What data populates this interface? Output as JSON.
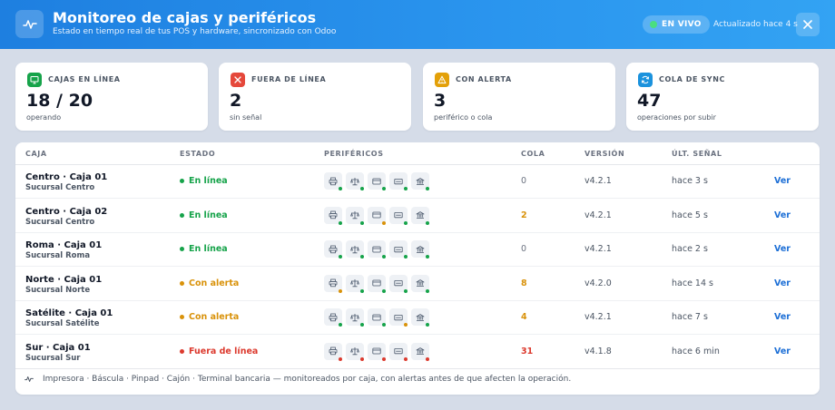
{
  "header": {
    "title": "Monitoreo de cajas y periféricos",
    "subtitle": "Estado en tiempo real de tus POS y hardware, sincronizado con Odoo",
    "live_label": "EN VIVO",
    "updated_label": "Actualizado hace 4 s"
  },
  "cards": [
    {
      "label": "CAJAS EN LÍNEA",
      "value": "18 / 20",
      "sub": "operando",
      "icon": "monitor-icon",
      "color": "#16a34a"
    },
    {
      "label": "FUERA DE LÍNEA",
      "value": "2",
      "sub": "sin señal",
      "icon": "x-icon",
      "color": "#e5483b"
    },
    {
      "label": "CON ALERTA",
      "value": "3",
      "sub": "periférico o cola",
      "icon": "warning-icon",
      "color": "#e3a008"
    },
    {
      "label": "COLA DE SYNC",
      "value": "47",
      "sub": "operaciones por subir",
      "icon": "sync-icon",
      "color": "#1b92dd"
    }
  ],
  "table": {
    "columns": [
      "CAJA",
      "ESTADO",
      "PERIFÉRICOS",
      "COLA",
      "VERSIÓN",
      "ÚLT. SEÑAL"
    ],
    "peripheral_icons": [
      "printer-icon",
      "scale-icon",
      "pinpad-icon",
      "drawer-icon",
      "terminal-icon"
    ],
    "rows": [
      {
        "name": "Centro · Caja 01",
        "branch": "Sucursal Centro",
        "status": "En línea",
        "status_kind": "ok",
        "peripherals": [
          "ok",
          "ok",
          "ok",
          "ok",
          "ok"
        ],
        "queue": "0",
        "queue_kind": "zero",
        "version": "v4.2.1",
        "signal": "hace 3 s",
        "action": "Ver"
      },
      {
        "name": "Centro · Caja 02",
        "branch": "Sucursal Centro",
        "status": "En línea",
        "status_kind": "ok",
        "peripherals": [
          "ok",
          "ok",
          "warn",
          "ok",
          "ok"
        ],
        "queue": "2",
        "queue_kind": "warn",
        "version": "v4.2.1",
        "signal": "hace 5 s",
        "action": "Ver"
      },
      {
        "name": "Roma · Caja 01",
        "branch": "Sucursal Roma",
        "status": "En línea",
        "status_kind": "ok",
        "peripherals": [
          "ok",
          "ok",
          "ok",
          "ok",
          "ok"
        ],
        "queue": "0",
        "queue_kind": "zero",
        "version": "v4.2.1",
        "signal": "hace 2 s",
        "action": "Ver"
      },
      {
        "name": "Norte · Caja 01",
        "branch": "Sucursal Norte",
        "status": "Con alerta",
        "status_kind": "warn",
        "peripherals": [
          "warn",
          "ok",
          "ok",
          "ok",
          "ok"
        ],
        "queue": "8",
        "queue_kind": "warn",
        "version": "v4.2.0",
        "signal": "hace 14 s",
        "action": "Ver"
      },
      {
        "name": "Satélite · Caja 01",
        "branch": "Sucursal Satélite",
        "status": "Con alerta",
        "status_kind": "warn",
        "peripherals": [
          "ok",
          "ok",
          "ok",
          "warn",
          "ok"
        ],
        "queue": "4",
        "queue_kind": "warn",
        "version": "v4.2.1",
        "signal": "hace 7 s",
        "action": "Ver"
      },
      {
        "name": "Sur · Caja 01",
        "branch": "Sucursal Sur",
        "status": "Fuera de línea",
        "status_kind": "err",
        "peripherals": [
          "err",
          "err",
          "err",
          "err",
          "err"
        ],
        "queue": "31",
        "queue_kind": "err",
        "version": "v4.1.8",
        "signal": "hace 6 min",
        "action": "Ver"
      }
    ]
  },
  "footer": {
    "text": "Impresora · Báscula · Pinpad · Cajón · Terminal bancaria — monitoreados por caja, con alertas antes de que afecten la operación.",
    "icon": "pulse-icon"
  },
  "colors": {
    "ok": "#16a34a",
    "warn": "#d9920a",
    "err": "#dc3a2e",
    "zero": "#6b7280",
    "accent": "#1d6fd6"
  }
}
